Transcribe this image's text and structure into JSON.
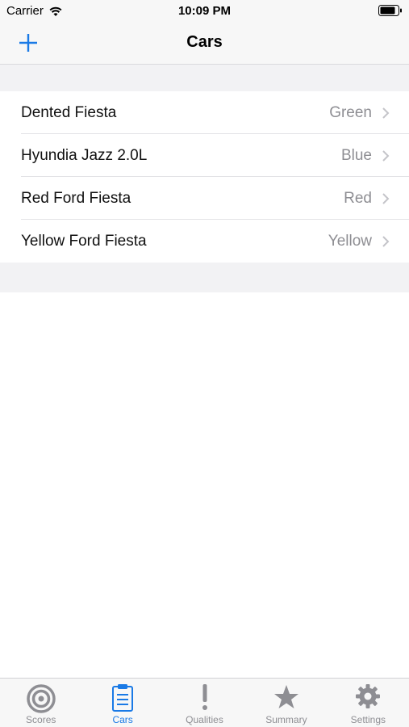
{
  "status": {
    "carrier": "Carrier",
    "time": "10:09 PM"
  },
  "nav": {
    "title": "Cars"
  },
  "cars": [
    {
      "name": "Dented Fiesta",
      "color": "Green"
    },
    {
      "name": "Hyundia Jazz 2.0L",
      "color": "Blue"
    },
    {
      "name": "Red Ford Fiesta",
      "color": "Red"
    },
    {
      "name": "Yellow Ford Fiesta",
      "color": "Yellow"
    }
  ],
  "tabs": [
    {
      "label": "Scores",
      "icon": "target-icon",
      "active": false
    },
    {
      "label": "Cars",
      "icon": "clipboard-icon",
      "active": true
    },
    {
      "label": "Qualities",
      "icon": "exclamation-icon",
      "active": false
    },
    {
      "label": "Summary",
      "icon": "star-icon",
      "active": false
    },
    {
      "label": "Settings",
      "icon": "gear-icon",
      "active": false
    }
  ],
  "colors": {
    "accent": "#1a7ae6",
    "inactive": "#8e8e93"
  }
}
